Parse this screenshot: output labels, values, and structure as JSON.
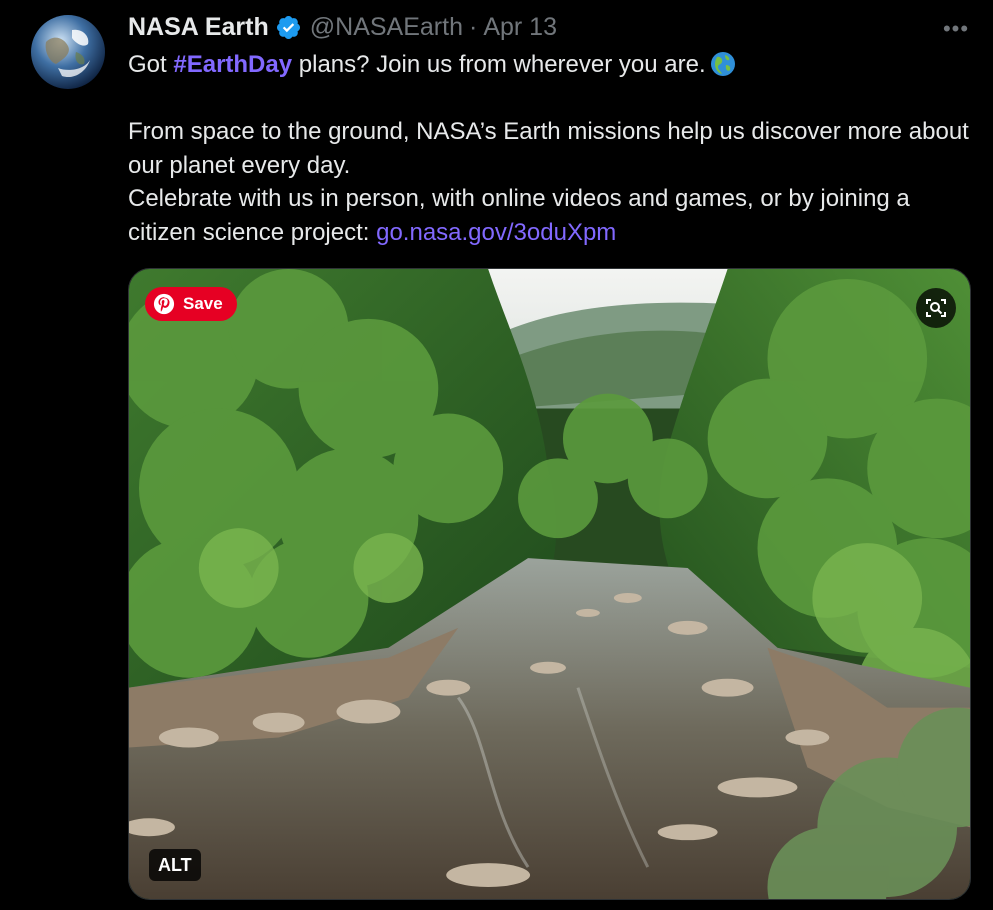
{
  "author": {
    "display_name": "NASA Earth",
    "handle": "@NASAEarth",
    "separator": "·",
    "date": "Apr 13",
    "avatar_icon": "earth-globe-avatar"
  },
  "menu": {
    "more_label": "•••"
  },
  "tweet": {
    "line1_prefix": "Got ",
    "hashtag": "#EarthDay",
    "line1_suffix": " plans? Join us from wherever you are.",
    "line1_emoji": "globe-americas-icon",
    "paragraph2": "From space to the ground, NASA’s Earth missions help us discover more about our planet every day.",
    "paragraph3_prefix": "Celebrate with us in person, with online videos and games, or by joining a citizen science project: ",
    "link": "go.nasa.gov/3oduXpm"
  },
  "media": {
    "save_label": "Save",
    "alt_label": "ALT",
    "lens_icon": "visual-search-icon"
  },
  "colors": {
    "background": "#000000",
    "text": "#e7e9ea",
    "muted": "#71767b",
    "accent": "#8269ff",
    "verified": "#1d9bf0",
    "pinterest": "#e60023"
  }
}
